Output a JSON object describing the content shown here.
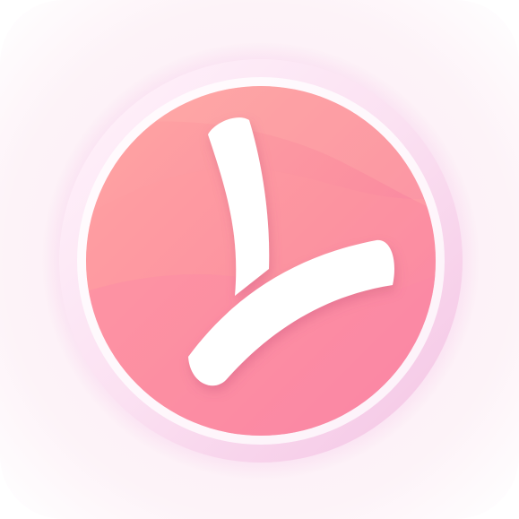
{
  "app_icon": {
    "icon": "pink-clock-check-icon",
    "colors": {
      "tile_background": "#fdf3f7",
      "ring_outer": "#f7d4ec",
      "ring_inner": "#ffffff",
      "disc_light": "#ffa5a2",
      "disc_mid": "#fb8f9f",
      "disc_dark": "#f77ba6",
      "hands": "#ffffff"
    }
  }
}
